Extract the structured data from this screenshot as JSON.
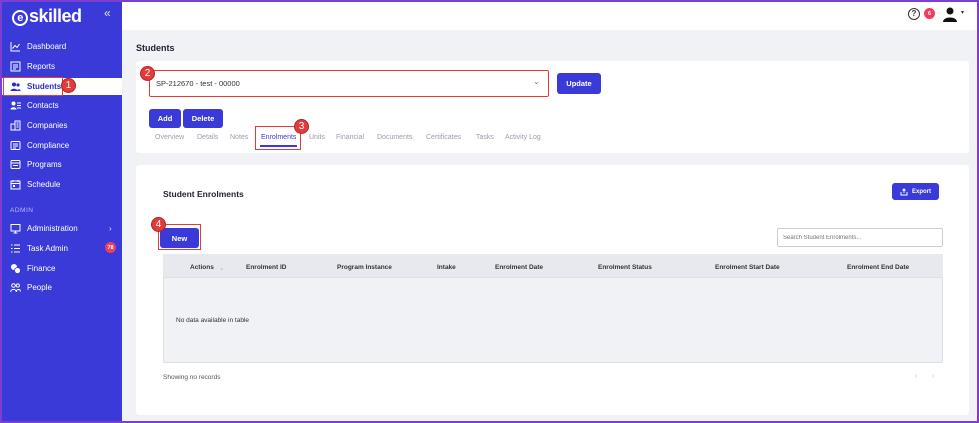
{
  "sidebar": {
    "logo": "skilled",
    "logo_letter": "e",
    "collapse": "«",
    "items": [
      {
        "label": "Dashboard",
        "icon": "chart-line-icon"
      },
      {
        "label": "Reports",
        "icon": "report-icon"
      },
      {
        "label": "Students",
        "icon": "users-icon"
      },
      {
        "label": "Contacts",
        "icon": "contacts-icon"
      },
      {
        "label": "Companies",
        "icon": "building-icon"
      },
      {
        "label": "Compliance",
        "icon": "compliance-icon"
      },
      {
        "label": "Programs",
        "icon": "programs-icon"
      },
      {
        "label": "Schedule",
        "icon": "calendar-icon"
      }
    ],
    "admin_label": "ADMIN",
    "admin_items": [
      {
        "label": "Administration",
        "icon": "monitor-icon"
      },
      {
        "label": "Task Admin",
        "icon": "list-icon",
        "badge": "78"
      },
      {
        "label": "Finance",
        "icon": "coins-icon"
      },
      {
        "label": "People",
        "icon": "people-icon"
      }
    ]
  },
  "topbar": {
    "help": "?",
    "notifications": "6"
  },
  "page": {
    "title": "Students"
  },
  "student_select": {
    "value": "SP-212670 - test - 00000"
  },
  "buttons": {
    "update": "Update",
    "add": "Add",
    "delete": "Delete",
    "export": "Export",
    "new": "New"
  },
  "tabs": [
    "Overview",
    "Details",
    "Notes",
    "Enrolments",
    "Units",
    "Financial",
    "Documents",
    "Certificates",
    "Tasks",
    "Activity Log"
  ],
  "enrolments": {
    "title": "Student Enrolments",
    "search_placeholder": "Search Student Enrolments...",
    "columns": [
      "Actions",
      "Enrolment ID",
      "Program Instance",
      "Intake",
      "Enrolment Date",
      "Enrolment Status",
      "Enrolment Start Date",
      "Enrolment End Date"
    ],
    "empty": "No data available in table",
    "footer": "Showing no records",
    "pager_prev": "‹",
    "pager_next": "›"
  },
  "steps": [
    "1",
    "2",
    "3",
    "4"
  ],
  "colors": {
    "brand": "#3a3ad8",
    "highlight": "#e23b3b"
  }
}
